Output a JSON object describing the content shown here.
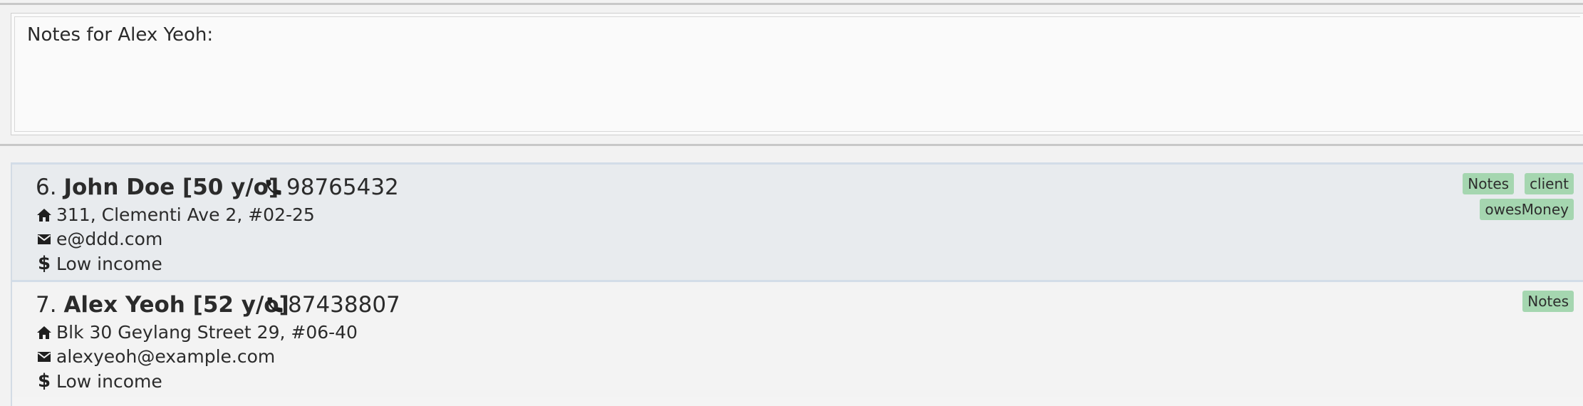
{
  "notes": {
    "label": "Notes for Alex Yeoh:"
  },
  "persons": [
    {
      "index": "6.",
      "name": "John Doe [50 y/o]",
      "phone": "98765432",
      "address": "311, Clementi Ave 2, #02-25",
      "email": "e@ddd.com",
      "income": "Low income",
      "tags": [
        "Notes",
        "client",
        "owesMoney"
      ]
    },
    {
      "index": "7.",
      "name": "Alex Yeoh [52 y/o]",
      "phone": "87438807",
      "address": "Blk 30 Geylang Street 29, #06-40",
      "email": "alexyeoh@example.com",
      "income": "Low income",
      "tags": [
        "Notes"
      ]
    }
  ],
  "colors": {
    "tag_background": "#a5d6b0",
    "selected_card": "#e8ebee",
    "card": "#f3f3f3",
    "text": "#2b2b2b"
  },
  "icons": {
    "phone": "phone-icon",
    "address": "home-icon",
    "email": "mail-icon",
    "income": "dollar-icon"
  }
}
